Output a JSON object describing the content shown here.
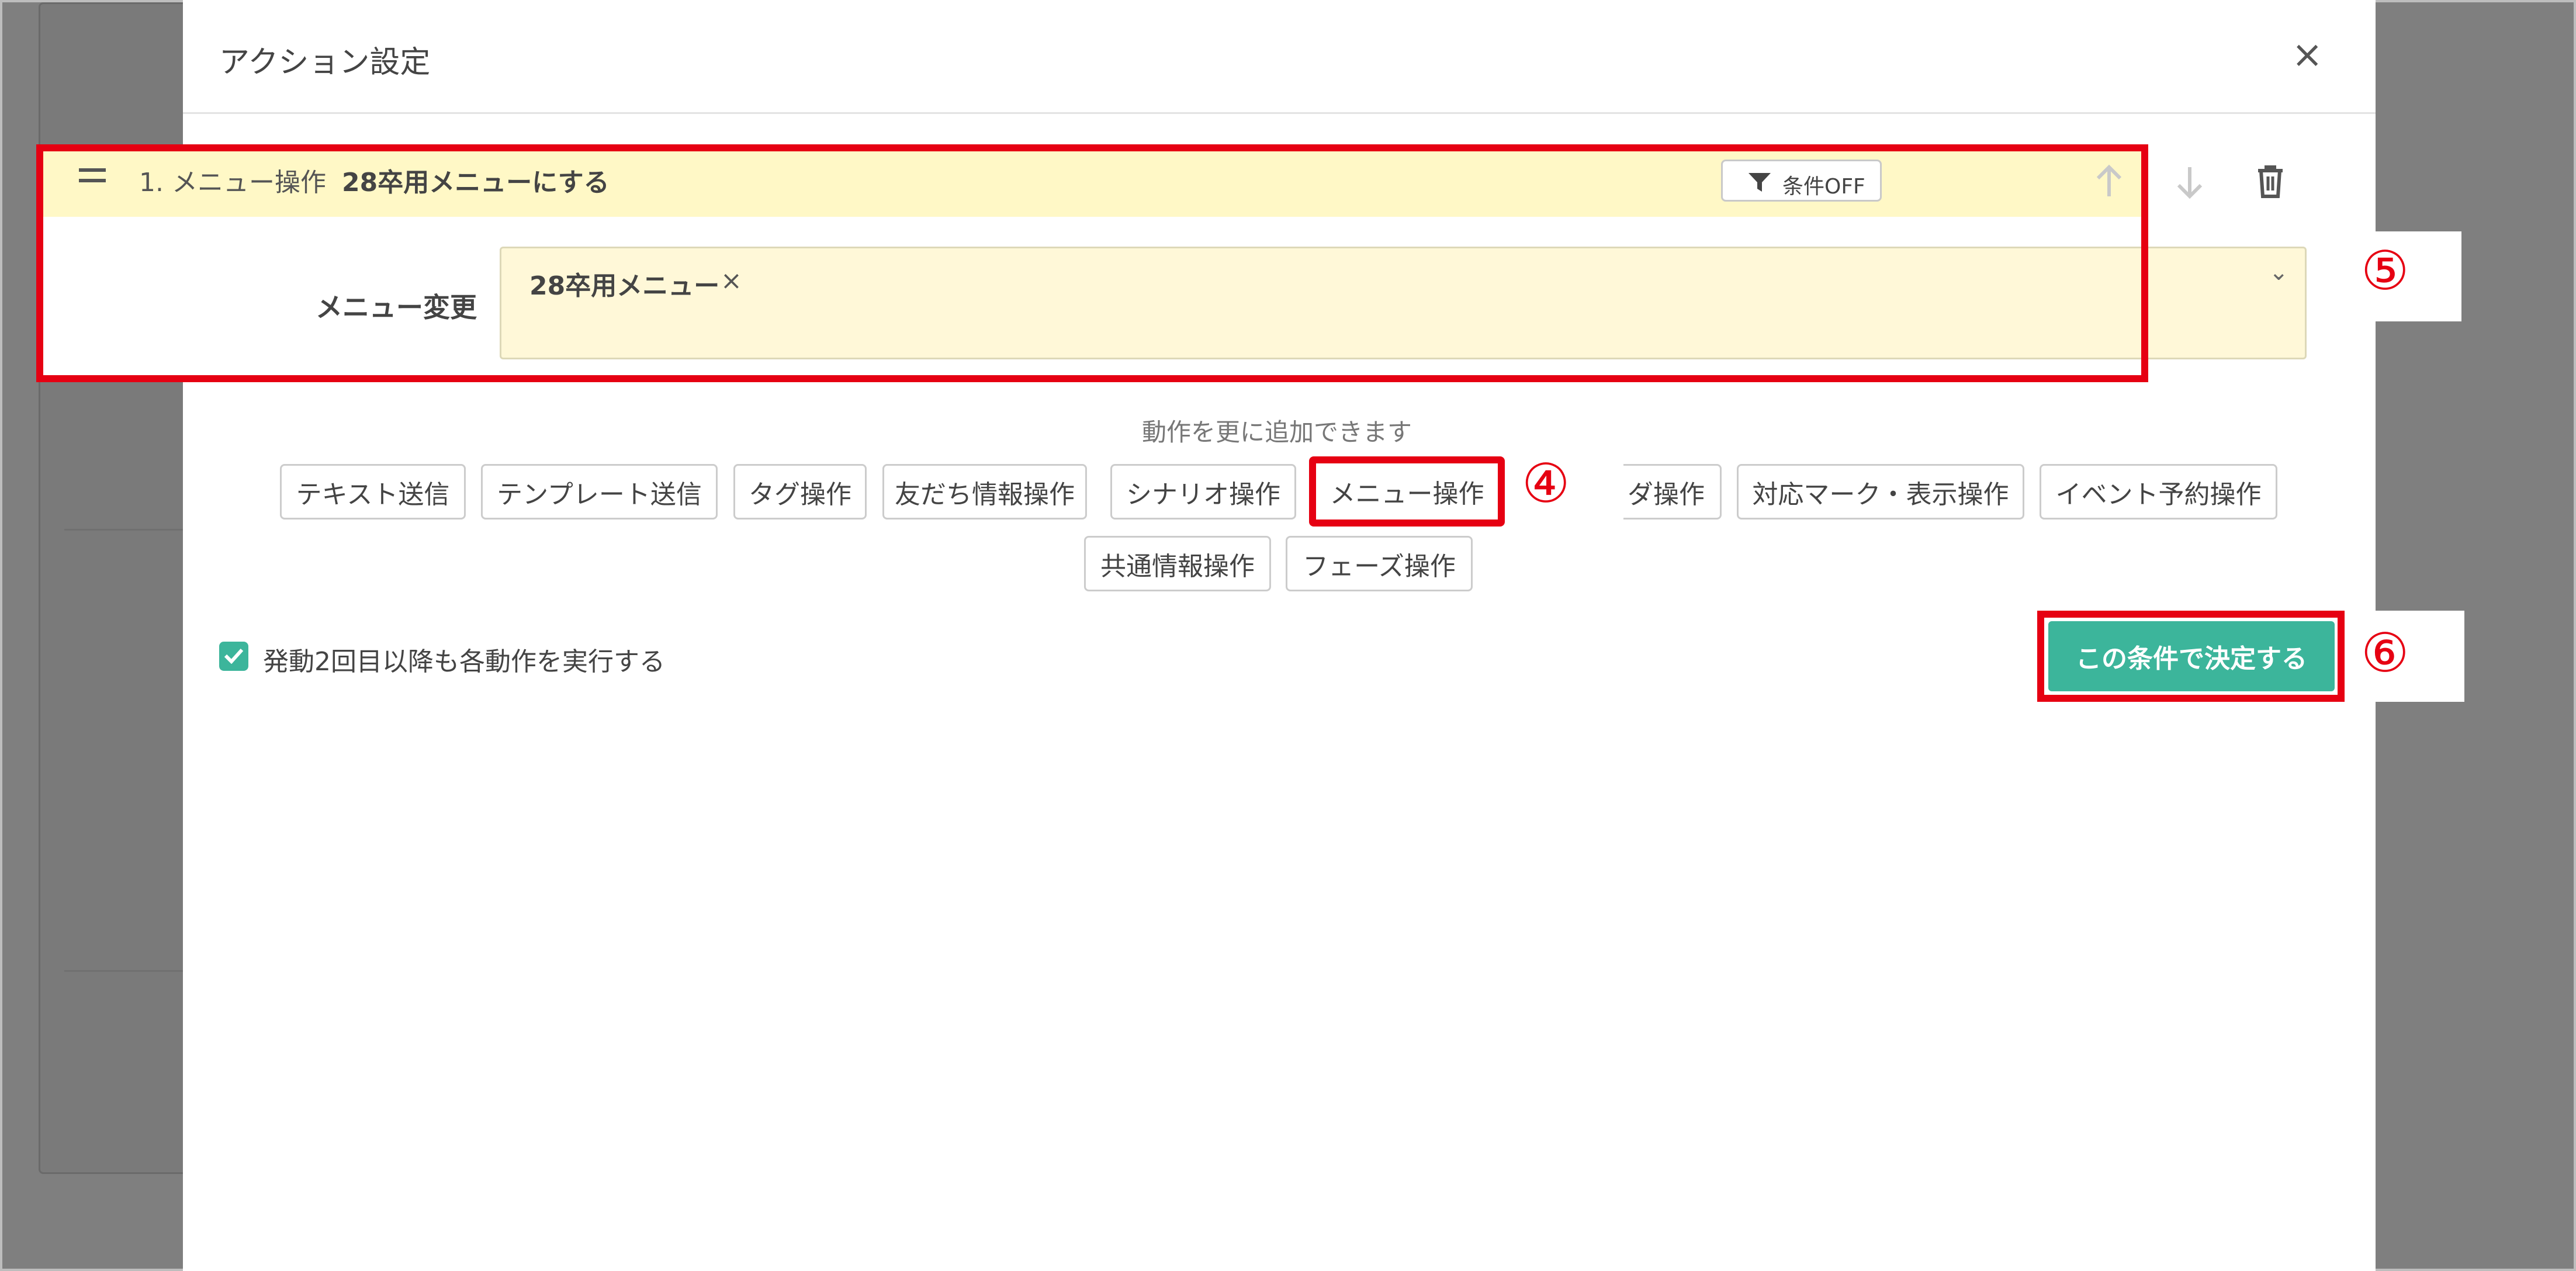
{
  "modal": {
    "title": "アクション設定",
    "close_label": "×"
  },
  "action": {
    "number": "1. メニュー操作",
    "summary": "28卒用メニューにする",
    "condition_button": "条件OFF",
    "field_label": "メニュー変更",
    "selected_value": "28卒用メニュー",
    "remove_label": "×",
    "dropdown_arrow": "⌄"
  },
  "add_actions": {
    "hint": "動作を更に追加できます",
    "chips": [
      "テキスト送信",
      "テンプレート送信",
      "タグ操作",
      "友だち情報操作",
      "シナリオ操作",
      "メニュー操作",
      "ダ操作",
      "対応マーク・表示操作",
      "イベント予約操作",
      "共通情報操作",
      "フェーズ操作"
    ]
  },
  "options": {
    "repeat_checked": true,
    "repeat_label": "発動2回目以降も各動作を実行する"
  },
  "confirm_button": "この条件で決定する",
  "annotations": {
    "four": "④",
    "five": "⑤",
    "six": "⑥"
  },
  "colors": {
    "accent_green": "#3cb59b",
    "highlight_red": "#e60012",
    "action_header_bg": "#fff8c6",
    "select_bg": "#fff8d8"
  },
  "icons": [
    "drag-handle-icon",
    "filter-icon",
    "arrow-up-icon",
    "arrow-down-icon",
    "trash-icon",
    "check-icon",
    "close-icon"
  ]
}
